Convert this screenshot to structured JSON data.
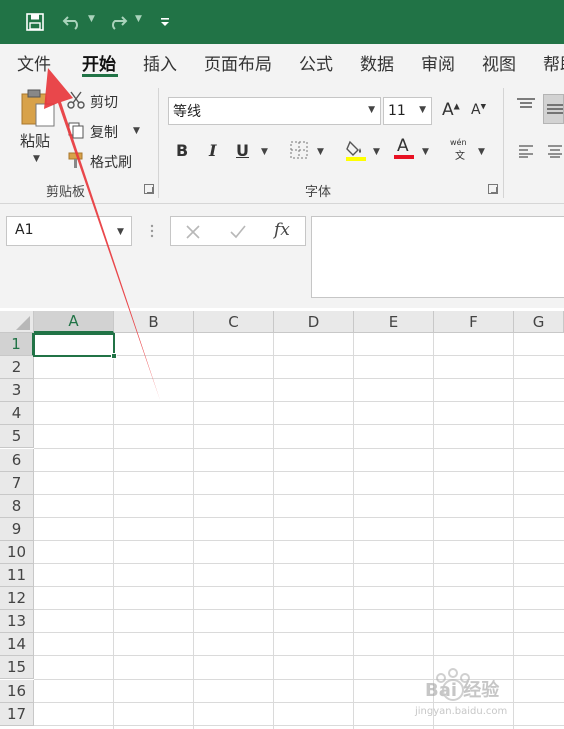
{
  "titlebar": {
    "quick_access": [
      "save-icon",
      "undo-icon",
      "redo-icon",
      "customize-icon"
    ],
    "color": "#217346"
  },
  "tabs": [
    "文件",
    "开始",
    "插入",
    "页面布局",
    "公式",
    "数据",
    "审阅",
    "视图",
    "帮助"
  ],
  "active_tab": "开始",
  "clipboard": {
    "paste": "粘贴",
    "cut": "剪切",
    "copy": "复制",
    "format_painter": "格式刷",
    "group_label": "剪贴板"
  },
  "font": {
    "name": "等线",
    "size": "11",
    "grow_label": "A",
    "shrink_label": "A",
    "bold": "B",
    "italic": "I",
    "underline": "U",
    "font_color_label": "A",
    "phonetic_top": "wén",
    "phonetic_bottom": "文",
    "group_label": "字体",
    "fill_color": "#ffff00",
    "font_color": "#e81123"
  },
  "formula_bar": {
    "name_box": "A1",
    "fx": "fx",
    "content": ""
  },
  "sheet": {
    "columns": [
      "A",
      "B",
      "C",
      "D",
      "E",
      "F",
      "G"
    ],
    "rows": [
      "1",
      "2",
      "3",
      "4",
      "5",
      "6",
      "7",
      "8",
      "9",
      "10",
      "11",
      "12",
      "13",
      "14",
      "15",
      "16",
      "17"
    ],
    "active_cell": "A1",
    "accent": "#217346"
  },
  "annotation": {
    "arrow_color": "#e8383d"
  },
  "watermark": {
    "text": "Bai 经验",
    "url": "jingyan.baidu.com"
  }
}
